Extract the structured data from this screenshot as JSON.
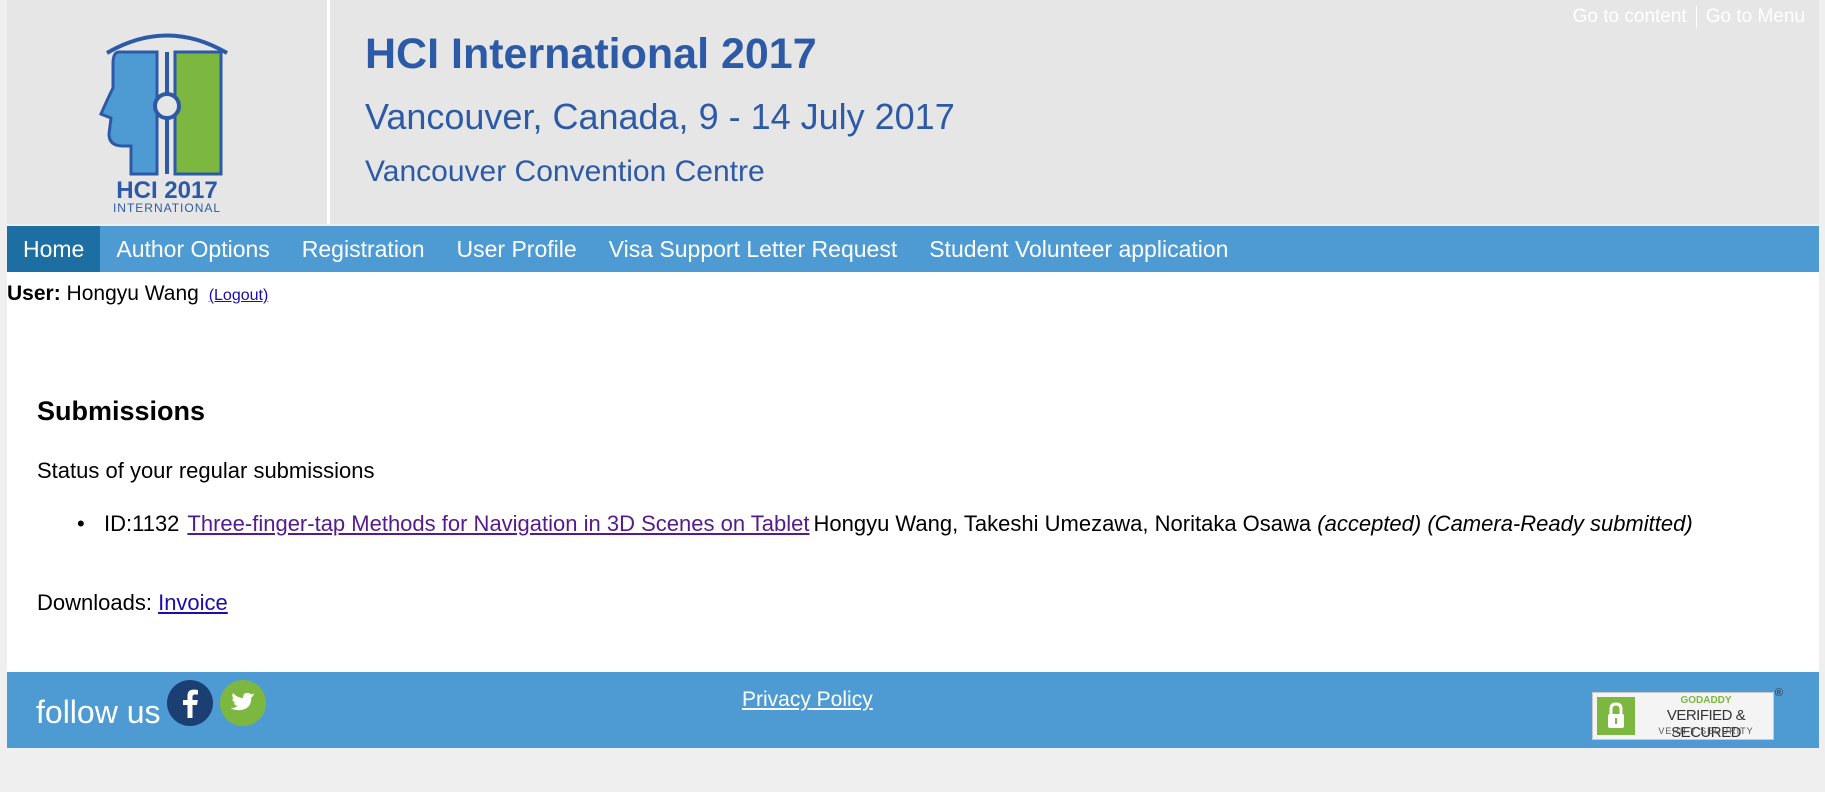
{
  "header": {
    "logo_text": "HCI 2017 INTERNATIONAL",
    "title": "HCI International 2017",
    "subtitle": "Vancouver, Canada, 9 - 14 July 2017",
    "venue": "Vancouver Convention Centre",
    "skip_content": "Go to content",
    "skip_menu": "Go to Menu"
  },
  "nav": {
    "items": [
      {
        "label": "Home",
        "active": true
      },
      {
        "label": "Author Options"
      },
      {
        "label": "Registration"
      },
      {
        "label": "User Profile"
      },
      {
        "label": "Visa Support Letter Request"
      },
      {
        "label": "Student Volunteer application"
      }
    ]
  },
  "user": {
    "label": "User:",
    "name": "Hongyu Wang",
    "logout": "(Logout)"
  },
  "submissions": {
    "heading": "Submissions",
    "status_text": "Status of your regular submissions",
    "items": [
      {
        "id": "ID:1132",
        "title": "Three-finger-tap Methods for Navigation in 3D Scenes on Tablet",
        "authors": "Hongyu Wang, Takeshi Umezawa, Noritaka Osawa",
        "status": "(accepted)",
        "camera_ready": "(Camera-Ready submitted)"
      }
    ],
    "downloads_label": "Downloads:",
    "invoice": "Invoice"
  },
  "footer": {
    "follow": "follow us",
    "privacy": "Privacy Policy",
    "seal": {
      "brand": "GODADDY",
      "main": "VERIFIED & SECURED",
      "sub": "VERIFY SECURITY",
      "reg": "®"
    }
  },
  "colors": {
    "nav_bg": "#4e9bd4",
    "nav_active": "#1d6fa3",
    "title_blue": "#2d5aa6",
    "header_bg": "#e6e6e6"
  }
}
